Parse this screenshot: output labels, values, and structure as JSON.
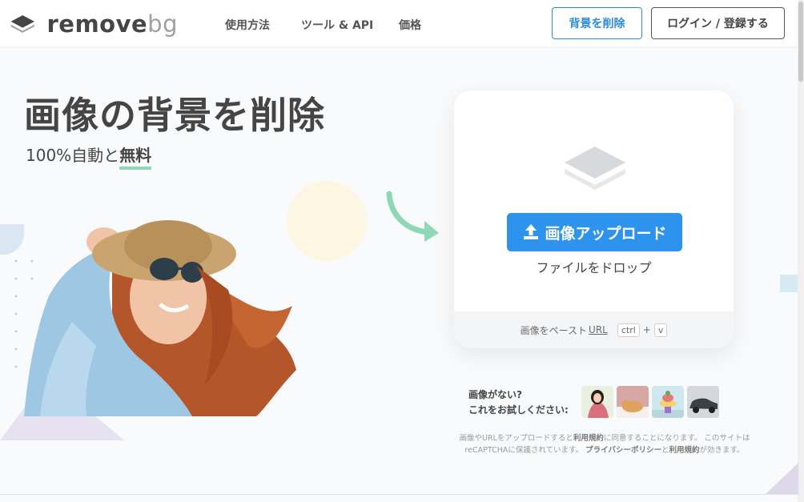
{
  "header": {
    "logo": {
      "word1": "remove",
      "word2": "bg"
    },
    "nav": [
      "使用方法",
      "ツール & API",
      "価格"
    ],
    "remove_bg_button": "背景を削除",
    "login_button": "ログイン / 登録する"
  },
  "hero": {
    "title": "画像の背景を削除",
    "subtitle_prefix": "100%自動と",
    "subtitle_highlight": "無料"
  },
  "upload": {
    "button_label": "画像アップロード",
    "drop_text": "ファイルをドロップ",
    "paste_prefix": "画像をペースト",
    "paste_url": "URL",
    "kbd_ctrl": "ctrl",
    "kbd_plus": "+",
    "kbd_v": "v"
  },
  "samples": {
    "line1": "画像がない?",
    "line2": "これをお試しください:"
  },
  "terms": {
    "l1_a": "画像やURLをアップロードすると",
    "l1_b": "利用規約",
    "l1_c": "に同意することになります。 このサイトは",
    "l2_a": "reCAPTCHAに保護されています。",
    "l2_b": "プライバシーポリシー",
    "l2_c": "と",
    "l2_d": "利用規約",
    "l2_e": "が効きます。"
  },
  "colors": {
    "accent_blue": "#2e93ec",
    "text_dark": "#454545",
    "highlight_green": "#8ed8b6"
  }
}
